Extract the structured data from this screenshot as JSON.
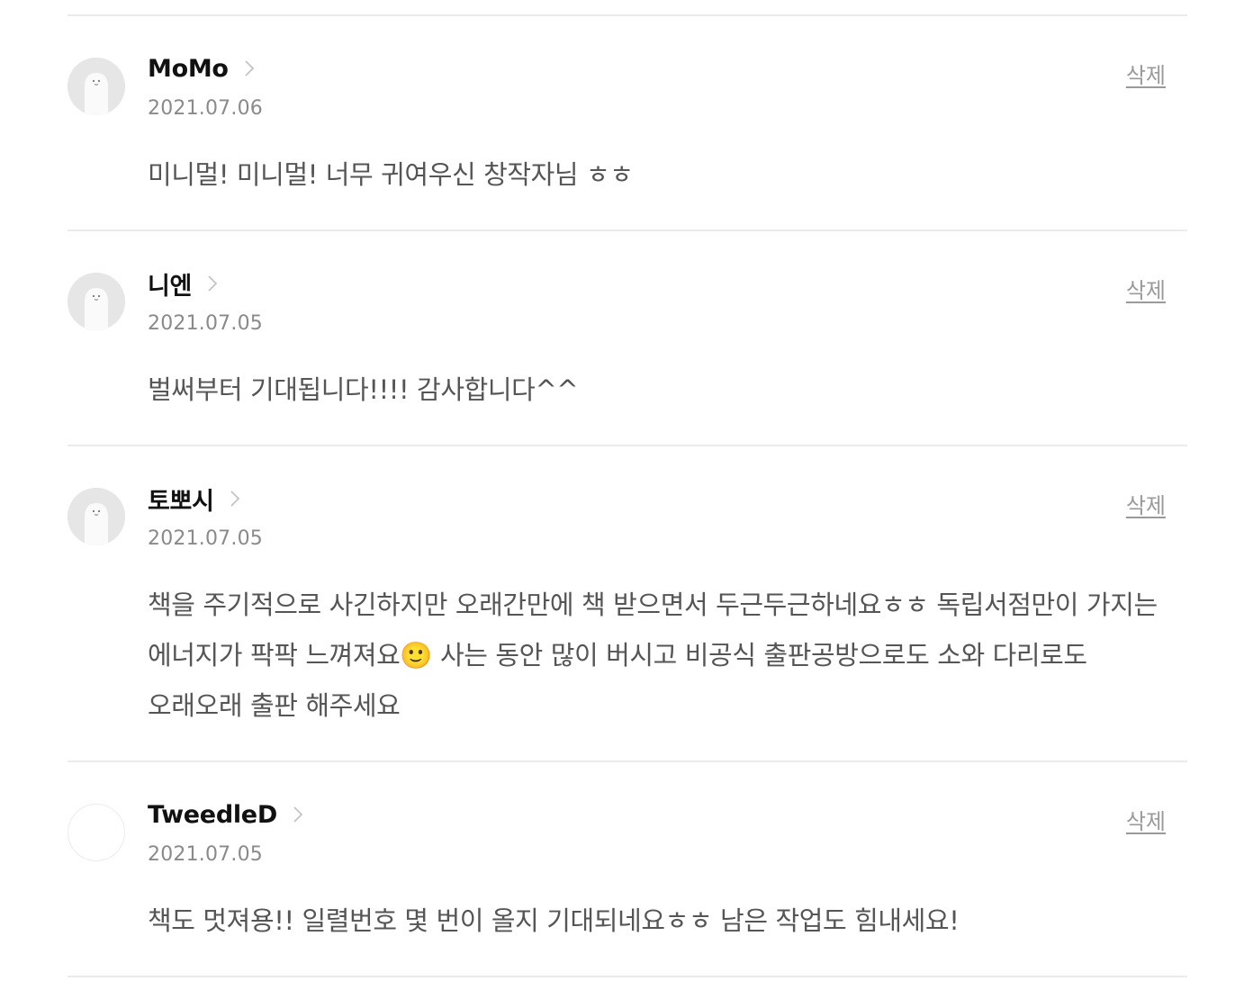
{
  "comments": [
    {
      "author": "MoMo",
      "date": "2021.07.06",
      "text": "미니멀! 미니멀! 너무 귀여우신 창작자님 ㅎㅎ",
      "delete_label": "삭제",
      "avatar": "ghost-avatar"
    },
    {
      "author": "니엔",
      "date": "2021.07.05",
      "text": "벌써부터 기대됩니다!!!! 감사합니다^^",
      "delete_label": "삭제",
      "avatar": "ghost-avatar"
    },
    {
      "author": "토뽀시",
      "date": "2021.07.05",
      "text": "책을 주기적으로 사긴하지만 오래간만에 책 받으면서 두근두근하네요ㅎㅎ 독립서점만이 가지는 에너지가 팍팍 느껴져요🙂 사는 동안 많이 버시고 비공식 출판공방으로도 소와 다리로도 오래오래 출판 해주세요",
      "delete_label": "삭제",
      "avatar": "ghost-avatar"
    },
    {
      "author": "TweedleD",
      "date": "2021.07.05",
      "text": "책도 멋져용!! 일렬번호 몇 번이 올지 기대되네요ㅎㅎ 남은 작업도 힘내세요!",
      "delete_label": "삭제",
      "avatar": "blank-avatar"
    }
  ],
  "colors": {
    "divider": "#ebebeb",
    "author": "#111111",
    "date": "#8a8a8a",
    "body_text": "#555555",
    "delete_link": "#9a9a9a",
    "avatar_bg": "#e6e6e6"
  }
}
